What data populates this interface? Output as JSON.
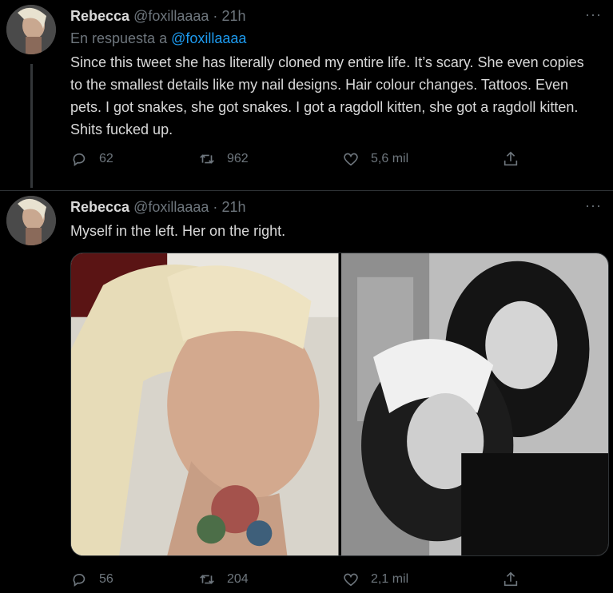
{
  "tweets": [
    {
      "name": "Rebecca",
      "handle": "@foxillaaaa",
      "dot": "·",
      "time": "21h",
      "reply_prefix": "En respuesta a",
      "reply_handle": "@foxillaaaa",
      "text": "Since this tweet she has literally cloned my entire life. It’s scary. She even copies to the smallest details like my nail designs. Hair colour changes. Tattoos. Even pets. I got snakes, she got snakes. I got a ragdoll kitten, she got a ragdoll kitten. Shits fucked up.",
      "replies": "62",
      "retweets": "962",
      "likes": "5,6 mil",
      "more": "···"
    },
    {
      "name": "Rebecca",
      "handle": "@foxillaaaa",
      "dot": "·",
      "time": "21h",
      "text": "Myself in the left. Her on the right.",
      "replies": "56",
      "retweets": "204",
      "likes": "2,1 mil",
      "more": "···"
    }
  ],
  "icons": {
    "reply": "reply-icon",
    "retweet": "retweet-icon",
    "like": "heart-icon",
    "share": "share-icon"
  },
  "colors": {
    "background": "#000000",
    "text": "#d9d9d9",
    "secondary": "#6e767d",
    "link": "#1d9bf0",
    "divider": "#2f3336"
  }
}
